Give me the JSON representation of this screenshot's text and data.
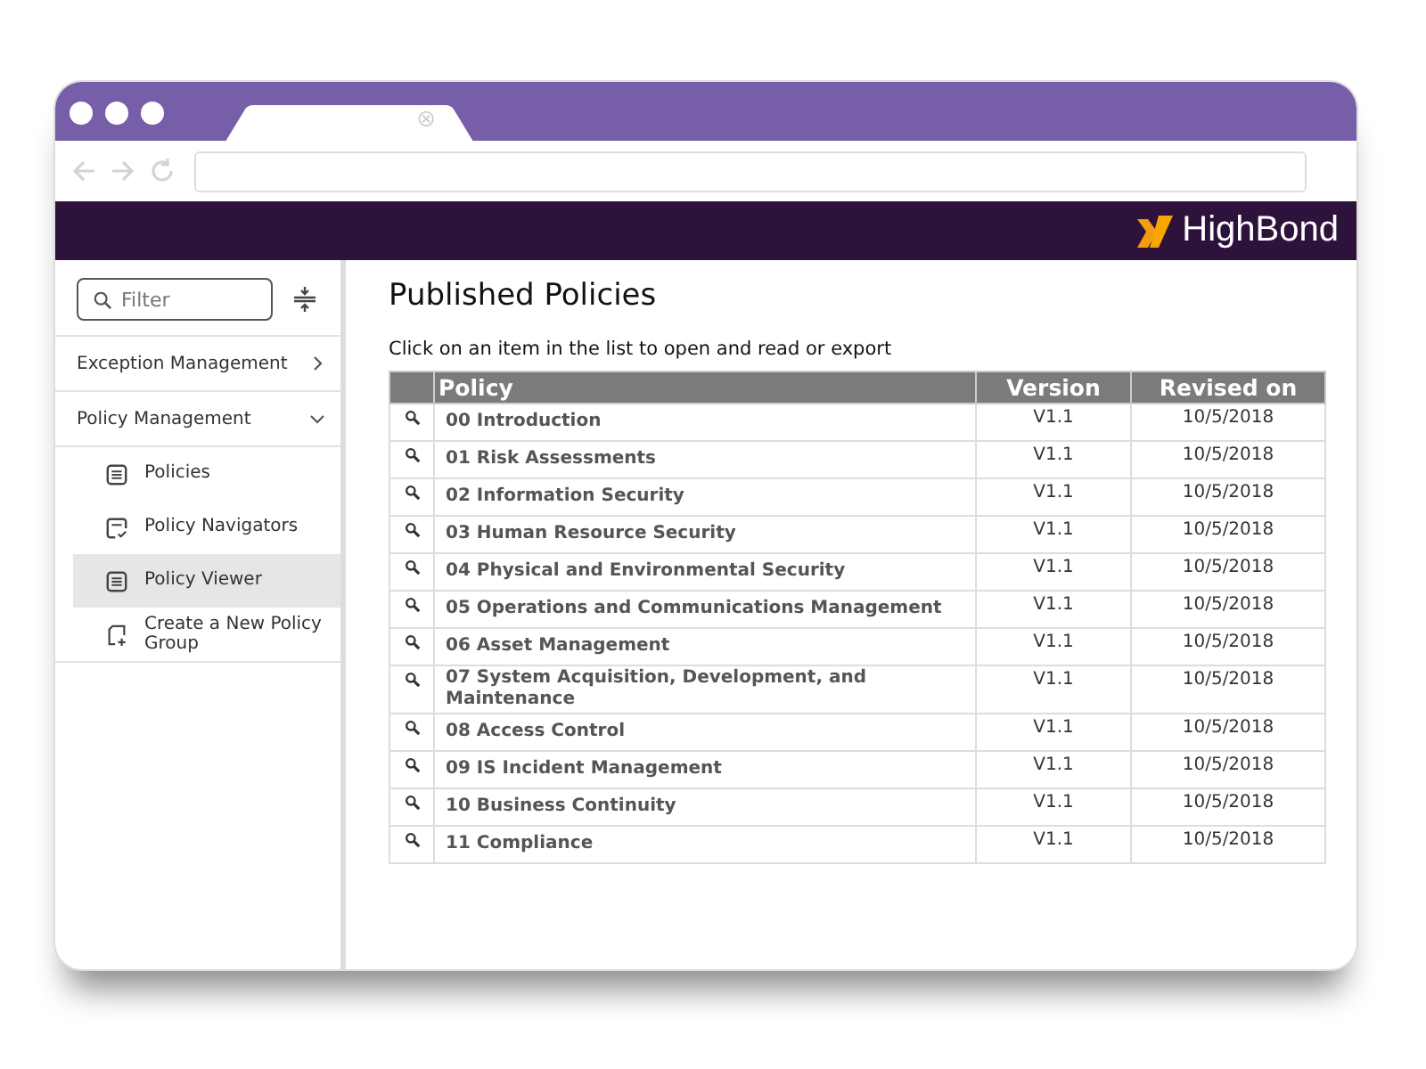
{
  "brand": {
    "name": "HighBond"
  },
  "filter": {
    "placeholder": "Filter"
  },
  "sidebar": {
    "items": [
      {
        "label": "Exception Management",
        "expanded": false
      },
      {
        "label": "Policy Management",
        "expanded": true,
        "children": [
          {
            "label": "Policies",
            "kind": "document",
            "selected": false
          },
          {
            "label": "Policy Navigators",
            "kind": "navigator",
            "selected": false
          },
          {
            "label": "Policy Viewer",
            "kind": "document",
            "selected": true
          },
          {
            "label": "Create a New Policy Group",
            "kind": "create",
            "selected": false
          }
        ]
      }
    ]
  },
  "page": {
    "title": "Published Policies",
    "instruction": "Click on an item in the list to open and read or export"
  },
  "table": {
    "columns": [
      "Policy",
      "Version",
      "Revised on"
    ],
    "rows": [
      {
        "policy": "00 Introduction",
        "version": "V1.1",
        "revised": "10/5/2018"
      },
      {
        "policy": "01 Risk Assessments",
        "version": "V1.1",
        "revised": "10/5/2018"
      },
      {
        "policy": "02 Information Security",
        "version": "V1.1",
        "revised": "10/5/2018"
      },
      {
        "policy": "03 Human Resource Security",
        "version": "V1.1",
        "revised": "10/5/2018"
      },
      {
        "policy": "04 Physical and Environmental Security",
        "version": "V1.1",
        "revised": "10/5/2018"
      },
      {
        "policy": "05 Operations and Communications Management",
        "version": "V1.1",
        "revised": "10/5/2018"
      },
      {
        "policy": "06 Asset Management",
        "version": "V1.1",
        "revised": "10/5/2018"
      },
      {
        "policy": "07 System Acquisition, Development, and Maintenance",
        "version": "V1.1",
        "revised": "10/5/2018"
      },
      {
        "policy": "08 Access Control",
        "version": "V1.1",
        "revised": "10/5/2018"
      },
      {
        "policy": "09 IS Incident Management",
        "version": "V1.1",
        "revised": "10/5/2018"
      },
      {
        "policy": "10 Business Continuity",
        "version": "V1.1",
        "revised": "10/5/2018"
      },
      {
        "policy": "11 Compliance",
        "version": "V1.1",
        "revised": "10/5/2018"
      }
    ]
  }
}
